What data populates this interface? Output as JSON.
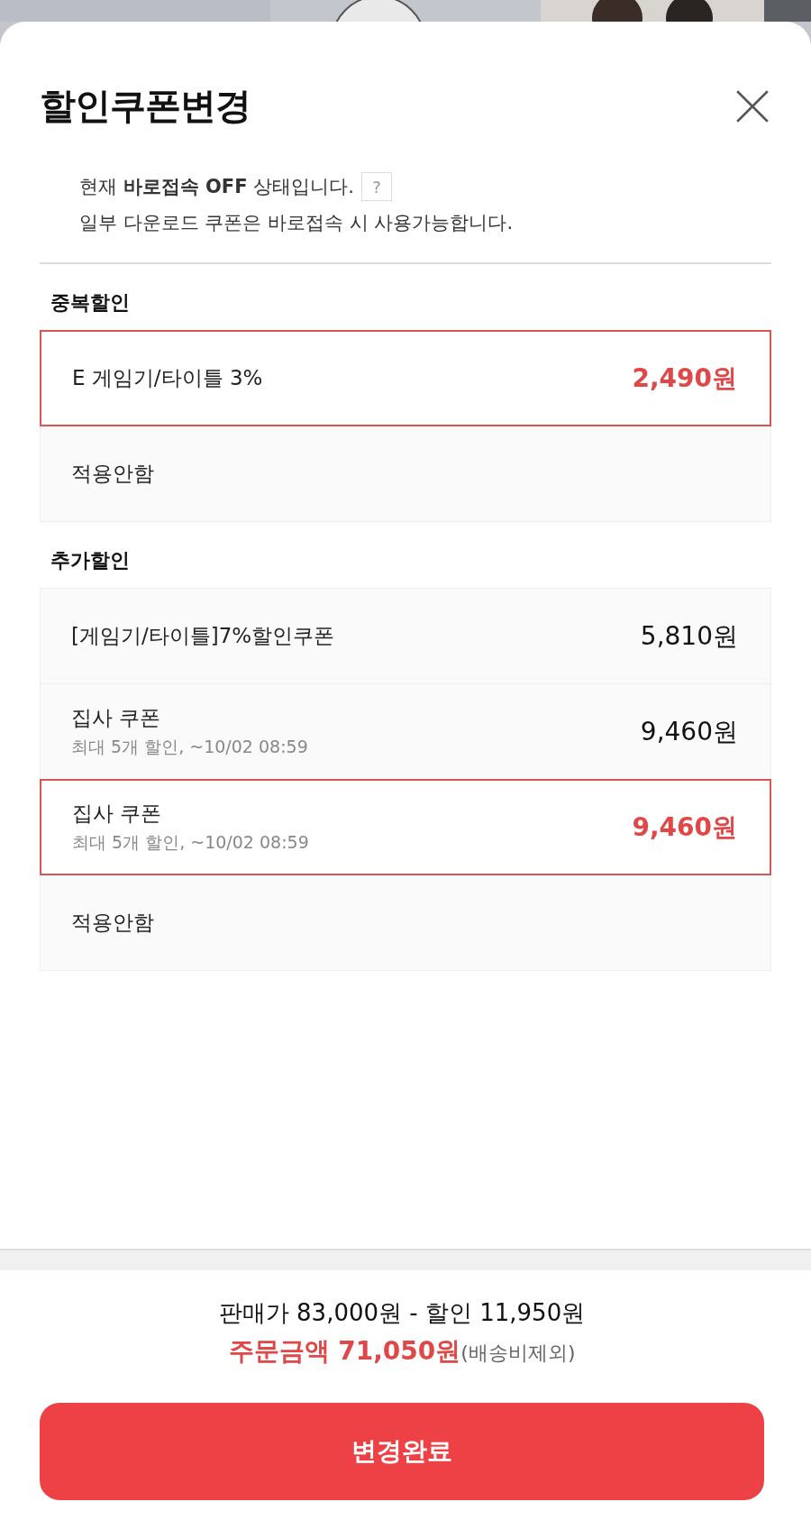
{
  "title": "할인쿠폰변경",
  "notice": {
    "line_1": "현재 **바로접속 OFF** 상태입니다.",
    "help": "?",
    "line_2": "일부 다운로드 쿠폰은 바로접속 시 사용가능합니다."
  },
  "sections": [
    {
      "heading": "중복할인",
      "options": [
        {
          "label": "E 게임기/타이틀 3%",
          "amount": "2,490원",
          "selected": true
        },
        {
          "label": "적용안함",
          "selected": false
        }
      ]
    },
    {
      "heading": "추가할인",
      "options": [
        {
          "label": "[게임기/타이틀]7%할인쿠폰",
          "amount": "5,810원",
          "selected": false
        },
        {
          "label": "집사 쿠폰",
          "detail": "최대 5개 할인, ~10/02 08:59",
          "amount": "9,460원",
          "selected": false
        },
        {
          "label": "집사 쿠폰",
          "detail": "최대 5개 할인, ~10/02 08:59",
          "amount": "9,460원",
          "selected": true
        },
        {
          "label": "적용안함",
          "selected": false
        }
      ]
    }
  ],
  "summary": {
    "line": "판매가 83,000원 - 할인 11,950원",
    "total": "주문금액 71,050원",
    "note": "(배송비제외)"
  },
  "button": "변경완료"
}
